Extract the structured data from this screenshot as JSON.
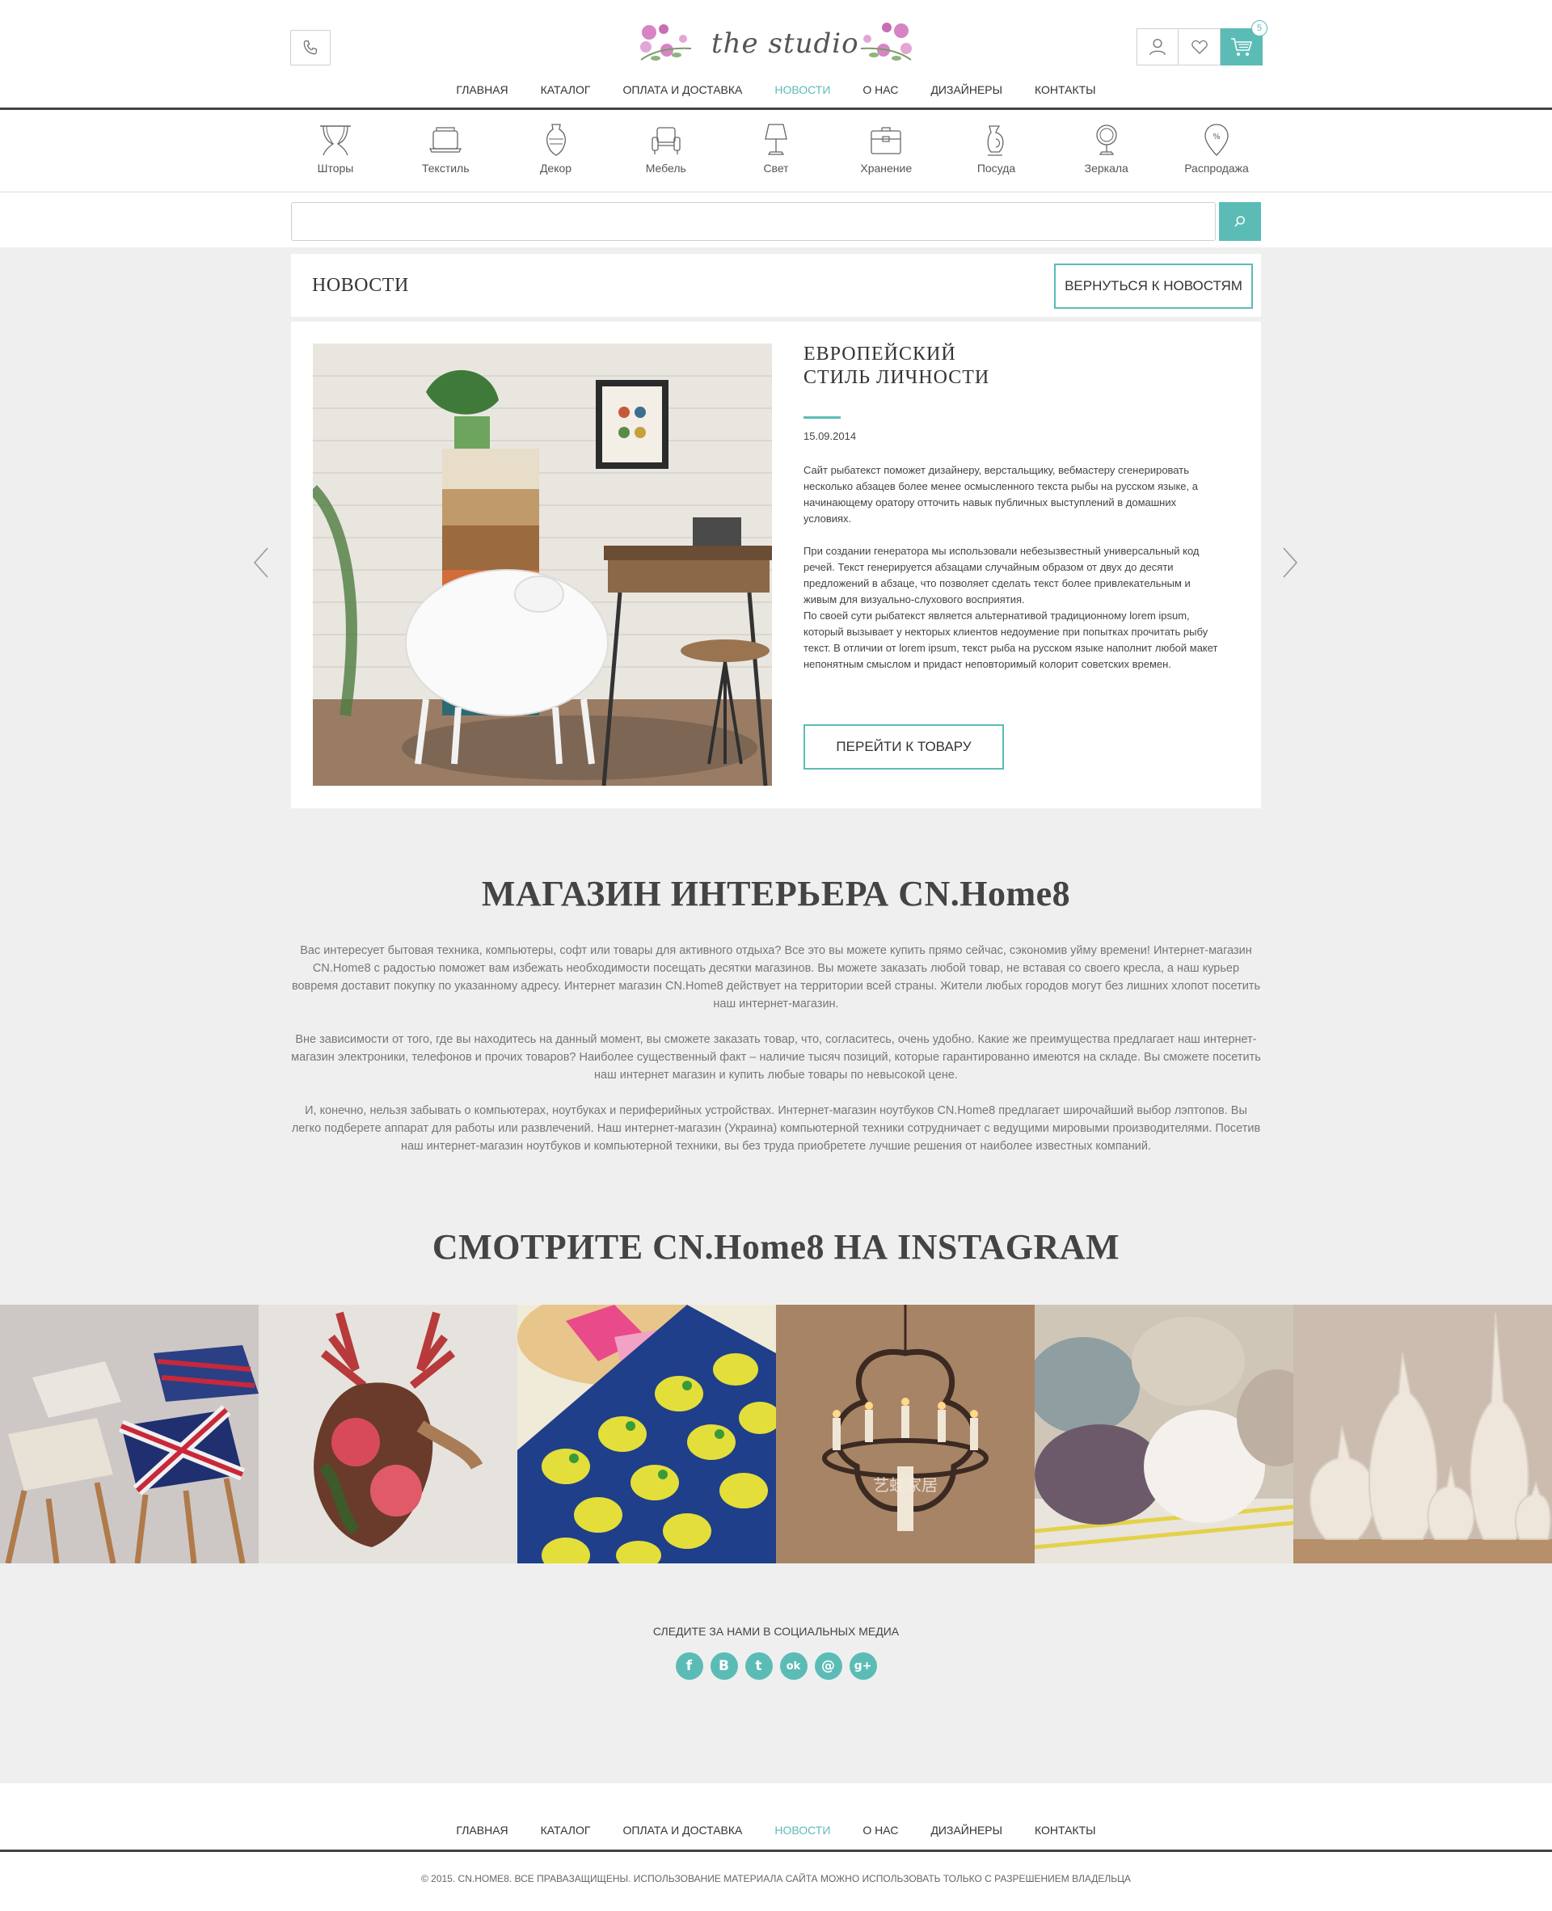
{
  "header": {
    "logo_text": "the studio",
    "cart_count": "5",
    "nav": [
      {
        "label": "Главная"
      },
      {
        "label": "Каталог"
      },
      {
        "label": "Оплата и доставка"
      },
      {
        "label": "Новости"
      },
      {
        "label": "О нас"
      },
      {
        "label": "Дизайнеры"
      },
      {
        "label": "Контакты"
      }
    ],
    "active_nav_index": 3,
    "accent_color": "#5bbcb6"
  },
  "categories": [
    {
      "label": "Шторы",
      "icon": "curtains-icon"
    },
    {
      "label": "Текстиль",
      "icon": "textile-icon"
    },
    {
      "label": "Декор",
      "icon": "vase-decor-icon"
    },
    {
      "label": "Мебель",
      "icon": "armchair-icon"
    },
    {
      "label": "Свет",
      "icon": "lamp-icon"
    },
    {
      "label": "Хранение",
      "icon": "storage-box-icon"
    },
    {
      "label": "Посуда",
      "icon": "tableware-icon"
    },
    {
      "label": "Зеркала",
      "icon": "mirror-icon"
    },
    {
      "label": "Распродажа",
      "icon": "sale-tag-icon"
    }
  ],
  "search": {
    "value": "",
    "placeholder": ""
  },
  "news": {
    "title": "Новости",
    "back_button": "Вернуться к новостям",
    "article": {
      "title": "Европейский стиль личности",
      "date": "15.09.2014",
      "body": "Сайт рыбатекст поможет дизайнеру, верстальщику, вебмастеру сгенерировать несколько абзацев более менее осмысленного текста рыбы на русском языке, а начинающему оратору отточить навык публичных выступлений в домашних условиях.\n\nПри создании генератора мы использовали небезызвестный универсальный код речей. Текст генерируется абзацами случайным образом от двух до десяти предложений в абзаце, что позволяет сделать текст более привлекательным и живым для визуально-слухового восприятия.\nПо своей сути рыбатекст является альтернативой традиционному lorem ipsum, который вызывает у некторых клиентов недоумение при попытках прочитать рыбу текст. В отличии от lorem ipsum, текст рыба на русском языке наполнит любой макет непонятным смыслом и придаст неповторимый колорит советских времен.",
      "button": "Перейти к товару"
    }
  },
  "about": {
    "title": "МАГАЗИН ИНТЕРЬЕРА CN.Home8",
    "paragraphs": [
      "Вас интересует бытовая техника, компьютеры, софт или товары для активного отдыха? Все это вы можете купить прямо сейчас, сэкономив уйму времени! Интернет-магазин CN.Home8 с радостью поможет вам избежать необходимости посещать десятки магазинов. Вы можете заказать любой товар, не вставая со своего кресла, а наш курьер вовремя доставит покупку по указанному адресу. Интернет магазин CN.Home8 действует на территории всей страны. Жители любых городов могут без лишних хлопот посетить наш интернет-магазин.",
      "Вне зависимости от того, где вы находитесь на данный момент, вы сможете заказать товар, что, согласитесь, очень удобно. Какие же преимущества предлагает наш интернет-магазин электроники, телефонов и прочих товаров? Наиболее существенный факт – наличие тысяч позиций, которые гарантированно имеются на складе. Вы сможете посетить наш интернет магазин и купить любые товары по невысокой цене.",
      "И, конечно, нельзя забывать о компьютерах, ноутбуках и периферийных устройствах. Интернет-магазин ноутбуков CN.Home8 предлагает широчайший выбор лэптопов. Вы легко подберете аппарат для работы или развлечений. Наш интернет-магазин (Украина) компьютерной техники сотрудничает с ведущими мировыми производителями. Посетив наш интернет-магазин ноутбуков и компьютерной техники, вы без труда приобретете лучшие решения от наиболее известных компаний."
    ]
  },
  "instagram": {
    "title": "СМОТРИТЕ CN.Home8 НА INSTAGRAM",
    "photos": [
      "stools-photo",
      "deer-head-photo",
      "strawberry-textile-photo",
      "chandelier-photo",
      "fur-pillows-photo",
      "white-vases-photo"
    ],
    "watermark": "艺蛙家居"
  },
  "social": {
    "label": "Следите за нами в социальных медиа",
    "icons": [
      {
        "name": "facebook-icon",
        "glyph": "f"
      },
      {
        "name": "vk-icon",
        "glyph": "B"
      },
      {
        "name": "twitter-icon",
        "glyph": "t"
      },
      {
        "name": "odnoklassniki-icon",
        "glyph": "ok"
      },
      {
        "name": "email-icon",
        "glyph": "@"
      },
      {
        "name": "google-plus-icon",
        "glyph": "g+"
      }
    ]
  },
  "footer": {
    "nav": [
      {
        "label": "Главная"
      },
      {
        "label": "Каталог"
      },
      {
        "label": "Оплата и доставка"
      },
      {
        "label": "Новости"
      },
      {
        "label": "О нас"
      },
      {
        "label": "Дизайнеры"
      },
      {
        "label": "Контакты"
      }
    ],
    "copyright": "© 2015. CN.HOME8. Все правазащищены. Использование материала сайта можно использовать только с разрешением владельца"
  }
}
